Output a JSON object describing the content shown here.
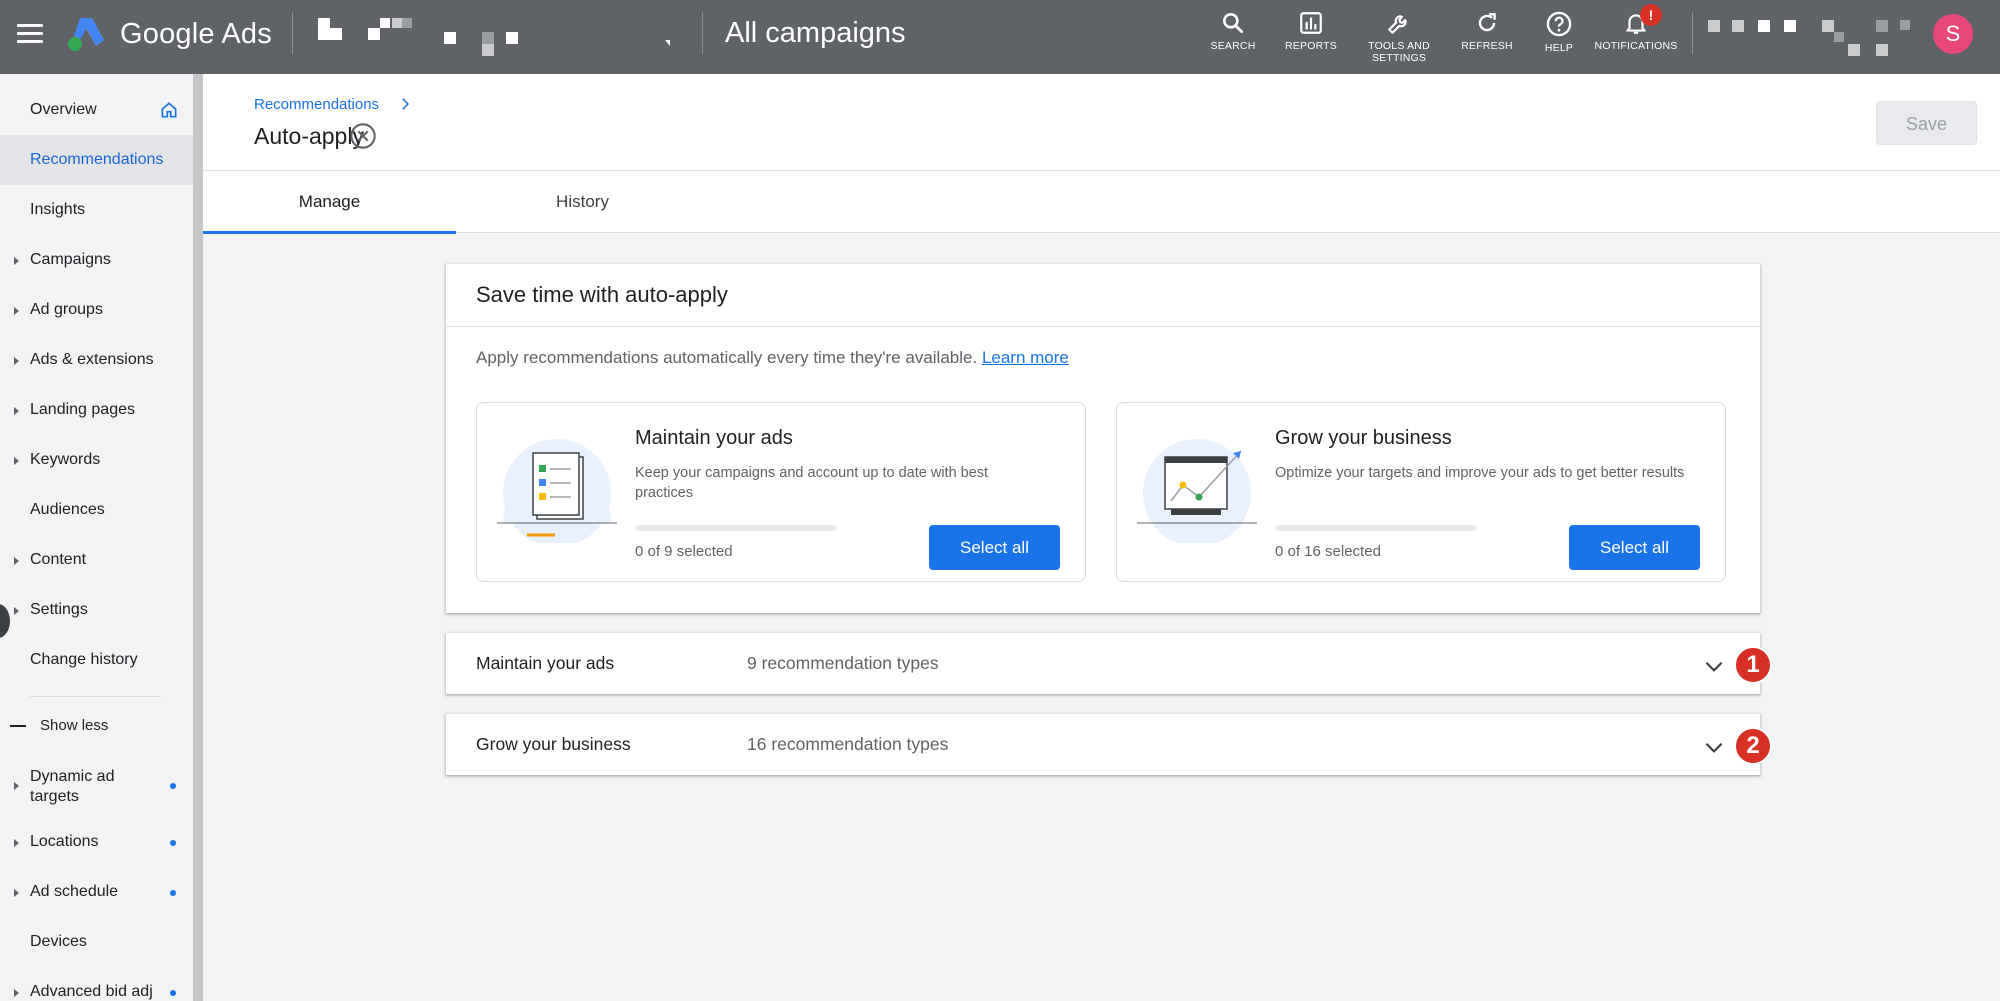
{
  "topbar": {
    "brand": "Google Ads",
    "title": "All campaigns",
    "actions": [
      {
        "label": "SEARCH",
        "icon": "search-icon"
      },
      {
        "label": "REPORTS",
        "icon": "reports-icon"
      },
      {
        "label": "TOOLS AND\nSETTINGS",
        "icon": "wrench-icon"
      },
      {
        "label": "REFRESH",
        "icon": "refresh-icon"
      },
      {
        "label": "HELP",
        "icon": "help-icon"
      },
      {
        "label": "NOTIFICATIONS",
        "icon": "bell-icon"
      }
    ],
    "notification_badge": "!",
    "avatar_initial": "S"
  },
  "sidebar": {
    "items": [
      {
        "label": "Overview"
      },
      {
        "label": "Recommendations"
      },
      {
        "label": "Insights"
      },
      {
        "label": "Campaigns"
      },
      {
        "label": "Ad groups"
      },
      {
        "label": "Ads & extensions"
      },
      {
        "label": "Landing pages"
      },
      {
        "label": "Keywords"
      },
      {
        "label": "Audiences"
      },
      {
        "label": "Content"
      },
      {
        "label": "Settings"
      },
      {
        "label": "Change history"
      }
    ],
    "show_less": "Show less",
    "more_items": [
      {
        "label": "Dynamic ad\ntargets"
      },
      {
        "label": "Locations"
      },
      {
        "label": "Ad schedule"
      },
      {
        "label": "Devices"
      },
      {
        "label": "Advanced bid adj"
      }
    ]
  },
  "header": {
    "breadcrumb": "Recommendations",
    "page_title": "Auto-apply",
    "save_label": "Save"
  },
  "tabs": [
    {
      "label": "Manage"
    },
    {
      "label": "History"
    }
  ],
  "promo": {
    "title": "Save time with auto-apply",
    "description": "Apply recommendations automatically every time they're available.",
    "learn_more": "Learn more",
    "tiles": [
      {
        "title": "Maintain your ads",
        "text": "Keep your campaigns and account up to date with best practices",
        "selected_count": "0 of 9 selected",
        "progress": 0,
        "button": "Select all"
      },
      {
        "title": "Grow your business",
        "text": "Optimize your targets and improve your ads to get better results",
        "selected_count": "0 of 16 selected",
        "progress": 0,
        "button": "Select all"
      }
    ]
  },
  "sections": [
    {
      "title": "Maintain your ads",
      "subtitle": "9 recommendation types",
      "badge": "1"
    },
    {
      "title": "Grow your business",
      "subtitle": "16 recommendation types",
      "badge": "2"
    }
  ],
  "colors": {
    "accent": "#1a73e8",
    "topbar": "#5f6368",
    "badge": "#d93025",
    "avatar": "#e8477a"
  }
}
